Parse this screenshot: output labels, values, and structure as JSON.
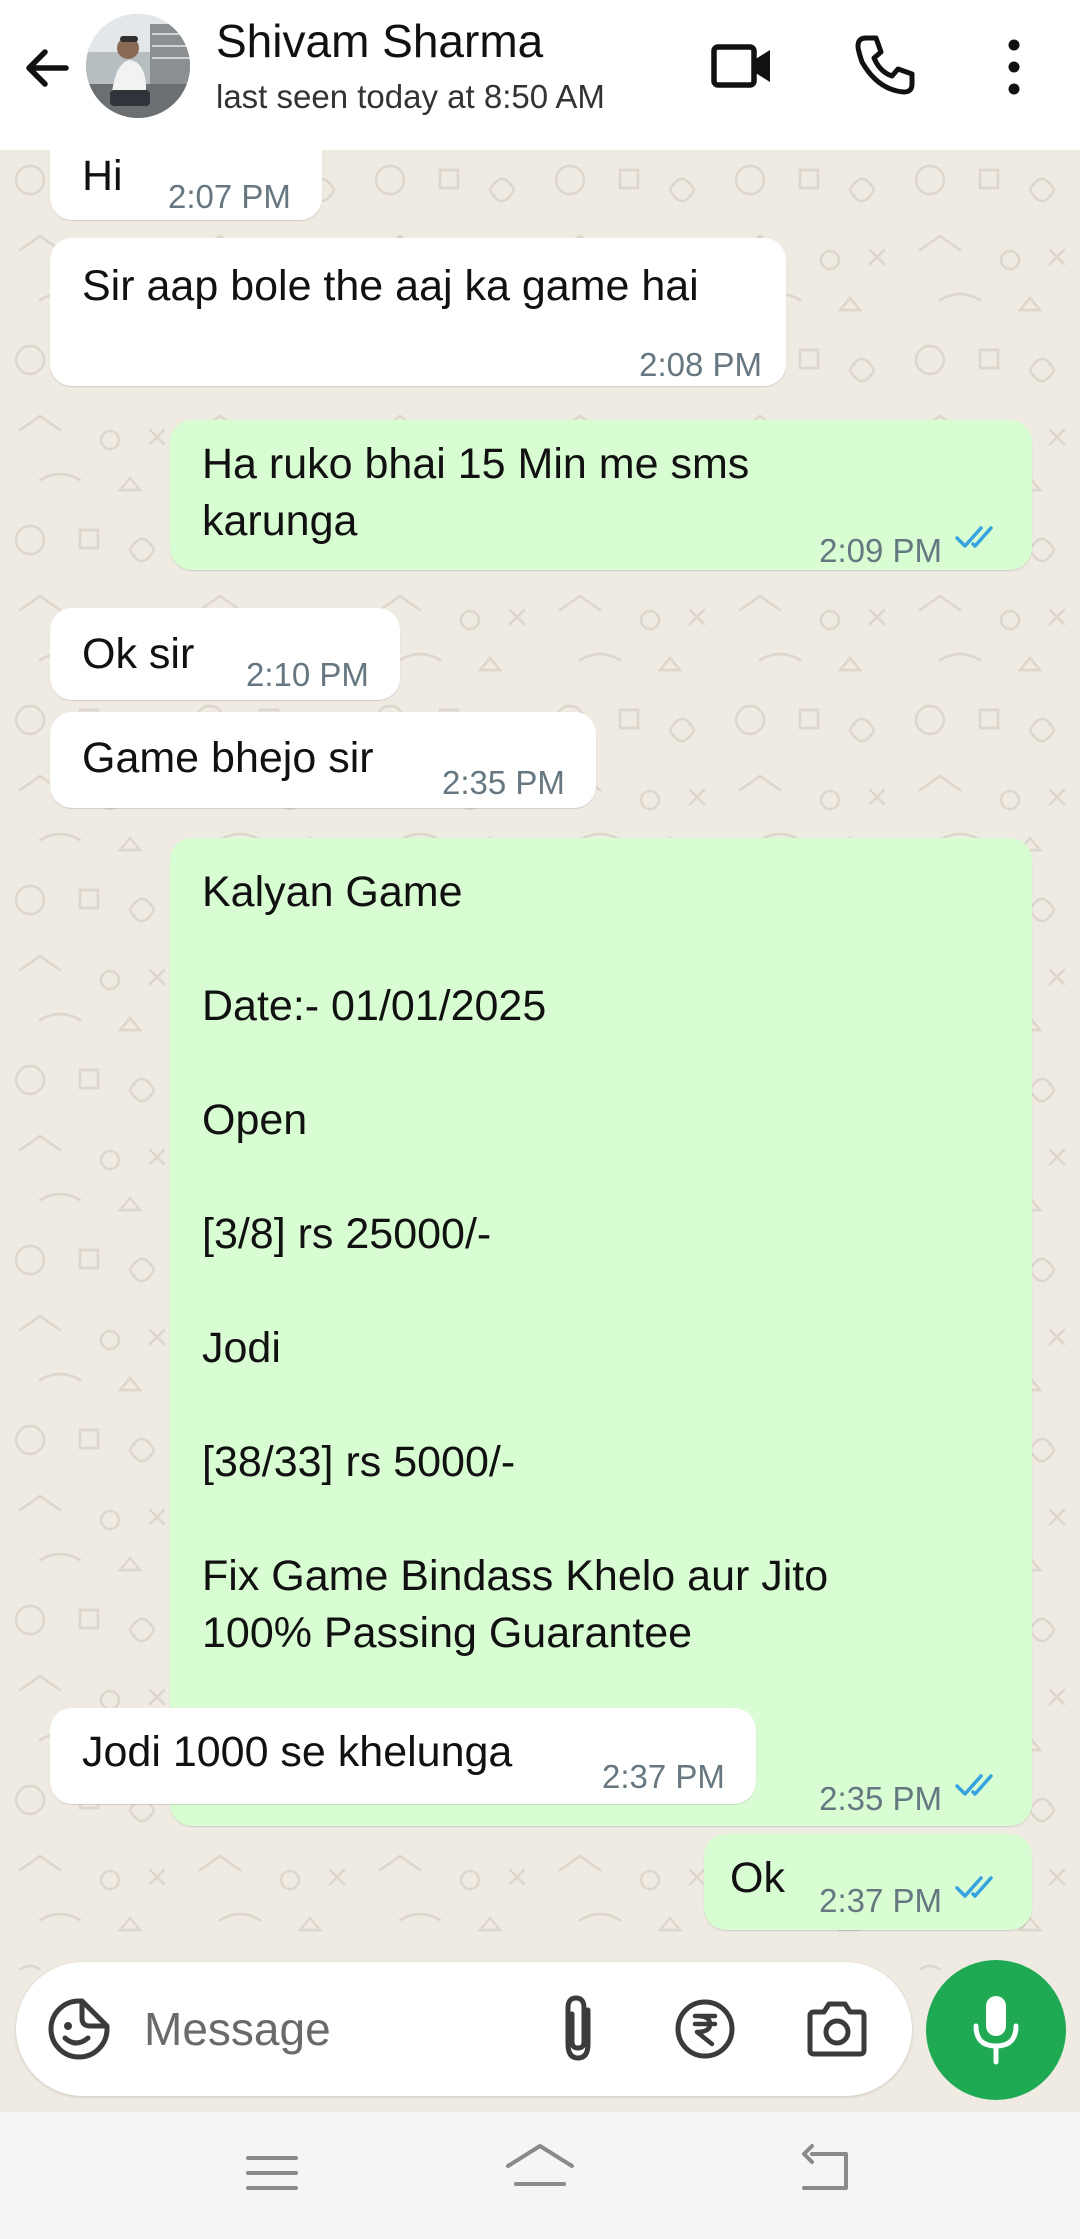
{
  "header": {
    "contact_name": "Shivam Sharma",
    "status": "last seen today at 8:50 AM",
    "icons": [
      "back-arrow-icon",
      "avatar",
      "video-call-icon",
      "phone-call-icon",
      "more-options-icon"
    ]
  },
  "messages": [
    {
      "direction": "incoming",
      "text": "Hi",
      "time": "2:07 PM"
    },
    {
      "direction": "incoming",
      "text": "Sir aap bole the aaj ka game hai",
      "time": "2:08 PM"
    },
    {
      "direction": "outgoing",
      "text": "Ha ruko bhai 15 Min me sms\nkarunga",
      "time": "2:09 PM",
      "status": "read"
    },
    {
      "direction": "incoming",
      "text": "Ok sir",
      "time": "2:10 PM"
    },
    {
      "direction": "incoming",
      "text": "Game bhejo sir",
      "time": "2:35 PM"
    },
    {
      "direction": "outgoing",
      "text": "Kalyan Game\n\nDate:- 01/01/2025\n\nOpen\n\n[3/8] rs 25000/-\n\nJodi\n\n[38/33] rs 5000/-\n\nFix Game Bindass Khelo aur Jito\n100% Passing Guarantee",
      "time": "2:35 PM",
      "status": "read"
    },
    {
      "direction": "incoming",
      "text": "Jodi 1000 se khelunga",
      "time": "2:37 PM"
    },
    {
      "direction": "outgoing",
      "text": "Ok",
      "time": "2:37 PM",
      "status": "read"
    }
  ],
  "compose": {
    "placeholder": "Message",
    "icons": [
      "emoji-sticker-icon",
      "attach-paperclip-icon",
      "rupee-payment-icon",
      "camera-icon",
      "mic-icon"
    ]
  },
  "navbar": {
    "icons": [
      "nav-menu-icon",
      "nav-home-icon",
      "nav-back-icon"
    ]
  },
  "colors": {
    "outgoing_bubble": "#d8fdd2",
    "incoming_bubble": "#ffffff",
    "chat_background": "#efeae2",
    "mic_button": "#1ea952",
    "read_ticks": "#34a3e0",
    "time_text": "#667781"
  }
}
